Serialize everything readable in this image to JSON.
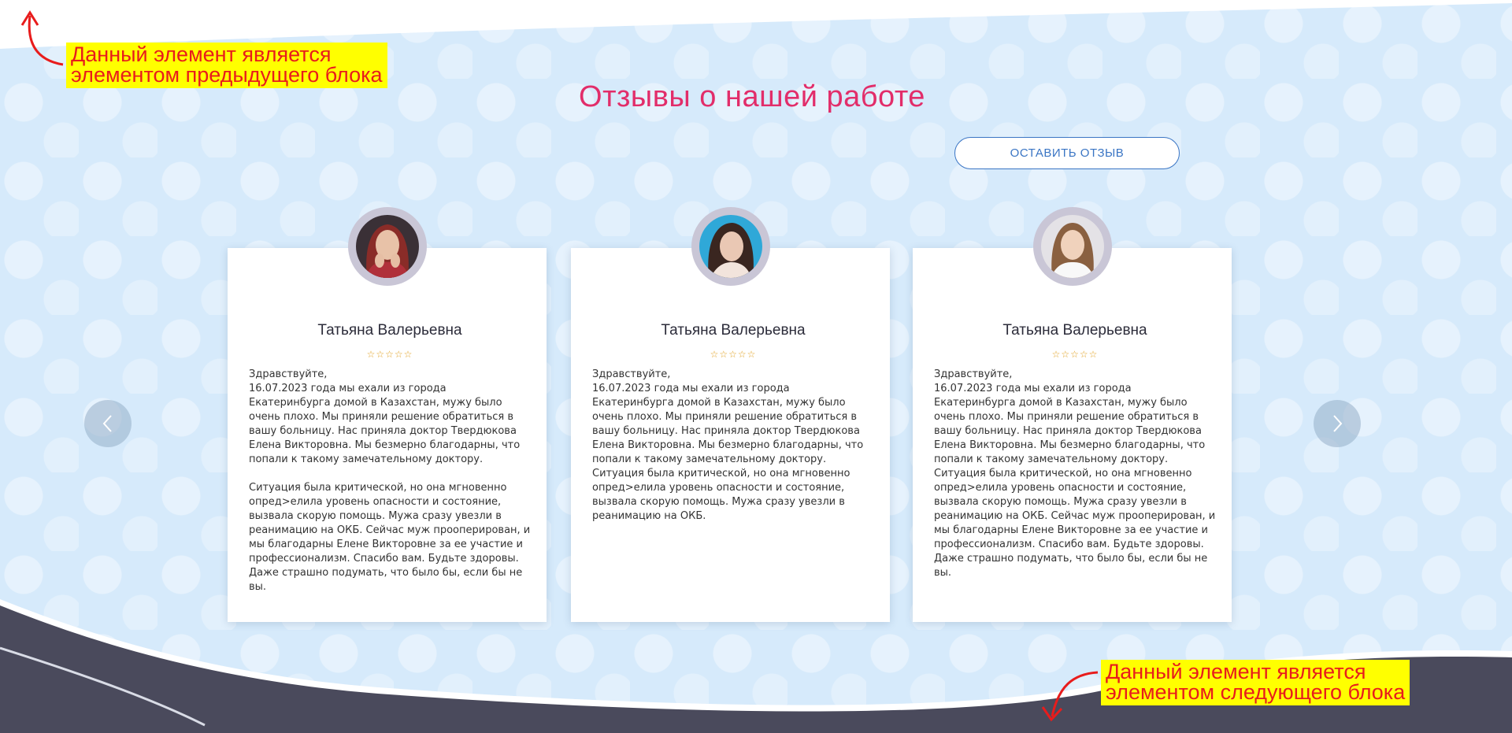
{
  "annotations": {
    "previous_block": [
      "Данный элемент является",
      "элементом предыдущего блока"
    ],
    "next_block": [
      "Данный элемент является",
      "элементом следующего блока"
    ]
  },
  "section": {
    "title": "Отзывы о нашей работе",
    "leave_review_label": "ОСТАВИТЬ ОТЗЫВ"
  },
  "colors": {
    "title": "#e22d6a",
    "button": "#3a75c4",
    "annotation_text": "#e81c1c",
    "annotation_bg": "#ffff00",
    "next_block_bg": "#4a4a5c"
  },
  "icons": {
    "prev": "chevron-left-icon",
    "next": "chevron-right-icon",
    "rating": "star-icon"
  },
  "reviews": [
    {
      "name": "Татьяна Валерьевна",
      "stars": "☆☆☆☆☆",
      "paragraphs": [
        "Здравствуйте,",
        "16.07.2023 года мы ехали из города Екатеринбурга домой в Казахстан, мужу было очень плохо. Мы приняли решение обратиться в вашу больницу. Нас приняла доктор Твердюкова Елена Викторовна. Мы безмерно благодарны, что попали к такому замечательному доктору.",
        "Ситуация была критической, но она мгновенно опред>елила уровень опасности и состояние, вызвала скорую помощь. Мужа сразу увезли в реанимацию на ОКБ. Сейчас муж прооперирован, и мы благодарны Елене Викторовне за ее участие и профессионализм. Спасибо вам. Будьте здоровы. Даже страшно подумать, что было бы, если бы не вы."
      ]
    },
    {
      "name": "Татьяна Валерьевна",
      "stars": "☆☆☆☆☆",
      "paragraphs": [
        "Здравствуйте,",
        "16.07.2023 года мы ехали из города Екатеринбурга домой в Казахстан, мужу было очень плохо. Мы приняли решение обратиться в вашу больницу. Нас приняла доктор Твердюкова Елена Викторовна. Мы безмерно благодарны, что попали к такому замечательному доктору.",
        "Ситуация была критической, но она мгновенно опред>елила уровень опасности и состояние, вызвала скорую помощь. Мужа сразу увезли в реанимацию на ОКБ."
      ]
    },
    {
      "name": "Татьяна Валерьевна",
      "stars": "☆☆☆☆☆",
      "paragraphs": [
        "Здравствуйте,",
        "16.07.2023 года мы ехали из города Екатеринбурга домой в Казахстан, мужу было очень плохо. Мы приняли решение обратиться в вашу больницу. Нас приняла доктор Твердюкова Елена Викторовна. Мы безмерно благодарны, что попали к такому замечательному доктору.",
        "Ситуация была критической, но она мгновенно опред>елила уровень опасности и состояние, вызвала скорую помощь. Мужа сразу увезли в реанимацию на ОКБ. Сейчас муж прооперирован, и мы благодарны Елене Викторовне за ее участие и профессионализм. Спасибо вам. Будьте здоровы. Даже страшно подумать, что было бы, если бы не вы."
      ]
    }
  ]
}
